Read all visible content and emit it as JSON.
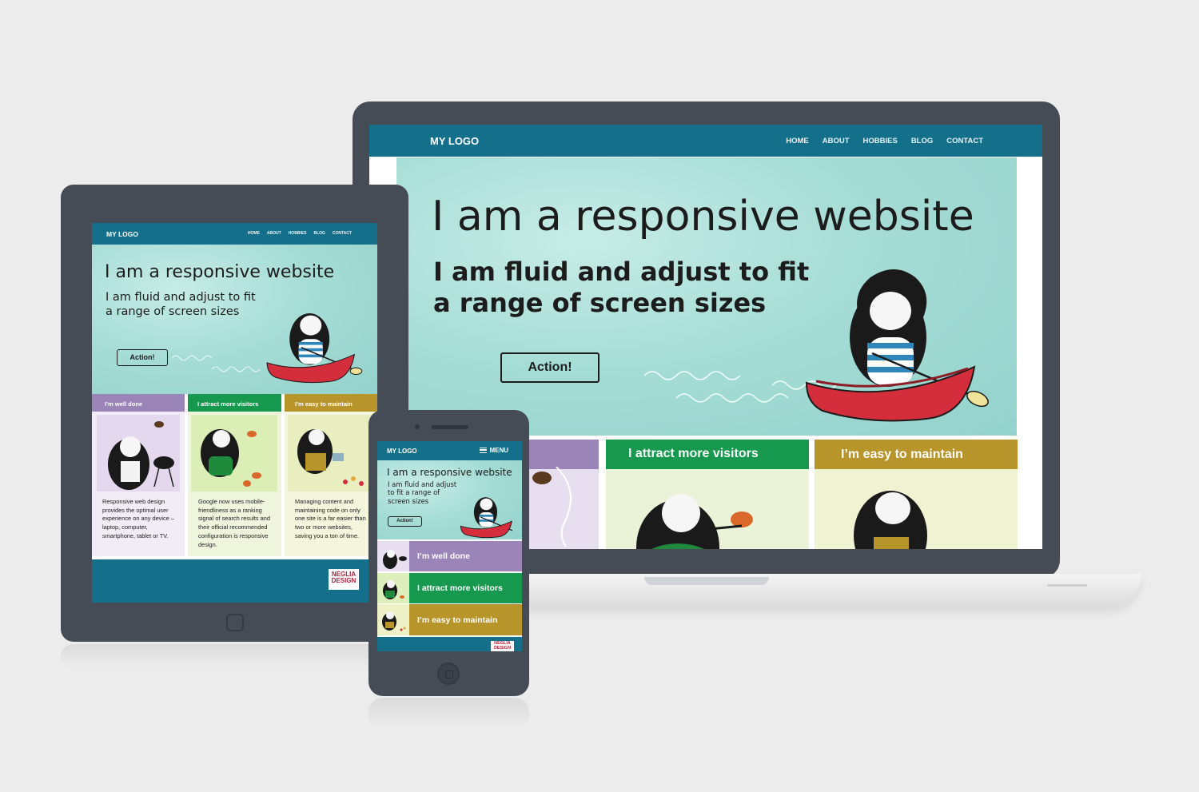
{
  "site": {
    "logo": "MY LOGO",
    "nav": [
      "HOME",
      "ABOUT",
      "HOBBIES",
      "BLOG",
      "CONTACT"
    ],
    "hero_title": "I am a responsive website",
    "hero_sub_line1": "I am fluid and adjust to fit",
    "hero_sub_line2": "a range of screen sizes",
    "action": "Action!",
    "cards": [
      {
        "title": "I’m well done",
        "text": "Responsive web design provides the optimal user experience on any device – laptop, computer, smartphone, tablet or TV.",
        "color": "#9a84b8"
      },
      {
        "title": "I attract more visitors",
        "text": "Google now uses mobile-friendliness as a ranking signal of search results and their official recommended configuration is responsive design.",
        "color": "#16994f"
      },
      {
        "title": "I’m easy to maintain",
        "text": "Managing content and maintaining code on only one site is a far easier than two or more websites, saving you a ton of time.",
        "color": "#b8952a"
      }
    ],
    "badge_line1": "NEGLIA",
    "badge_line2": "DESIGN"
  },
  "phone": {
    "menu_label": "MENU",
    "hero_sub_line1": "I am fluid and adjust",
    "hero_sub_line2": "to fit a range of",
    "hero_sub_line3": "screen sizes"
  },
  "colors": {
    "nav": "#146f8b",
    "frame": "#454c56",
    "hero": "#a6ddd6",
    "canoe": "#d42e3c",
    "purple": "#9a84b8",
    "green": "#16994f",
    "gold": "#b8952a"
  }
}
